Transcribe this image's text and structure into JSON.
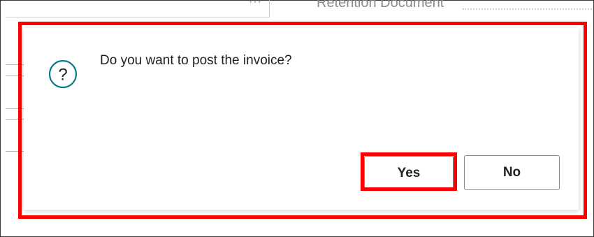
{
  "background": {
    "more_label": "···",
    "field_label": "Retention Document"
  },
  "dialog": {
    "icon": "question-circle-icon",
    "message": "Do you want to post the invoice?",
    "yes_label": "Yes",
    "no_label": "No"
  },
  "colors": {
    "highlight": "#ff0000",
    "icon_accent": "#0b7b8a"
  }
}
